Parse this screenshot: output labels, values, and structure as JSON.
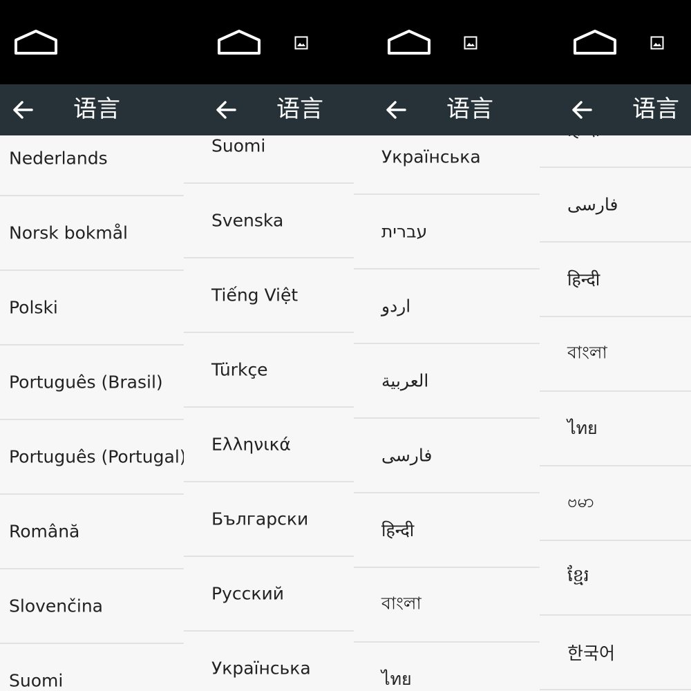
{
  "title": "语言",
  "panels": [
    {
      "has_image_icon": false,
      "items": [
        "Nederlands",
        "Norsk bokmål",
        "Polski",
        "Português (Brasil)",
        "Português (Portugal)",
        "Română",
        "Slovenčina",
        "Suomi"
      ]
    },
    {
      "has_image_icon": true,
      "items": [
        "Suomi",
        "Svenska",
        "Tiếng Việt",
        "Türkçe",
        "Ελληνικά",
        "Български",
        "Русский",
        "Українська"
      ]
    },
    {
      "has_image_icon": true,
      "items": [
        "Українська",
        "עברית",
        "اردو",
        "العربية",
        "فارسی",
        "हिन्दी",
        "বাংলা",
        "ไทย"
      ]
    },
    {
      "has_image_icon": true,
      "items": [
        "हिन्दी",
        "فارسی",
        "हिन्दी",
        "বাংলা",
        "ไทย",
        "ဗမာ",
        "ខ្មែរ",
        "한국어"
      ]
    }
  ],
  "colors": {
    "status_bar": "#000000",
    "action_bar": "#263238",
    "list_background": "#f7f7f7",
    "divider": "#e2e2e2",
    "title_text": "#ffffff",
    "item_text": "#222222"
  },
  "icons": {
    "home": "home-outline-icon",
    "image": "image-notification-icon",
    "back": "arrow-left-icon"
  }
}
